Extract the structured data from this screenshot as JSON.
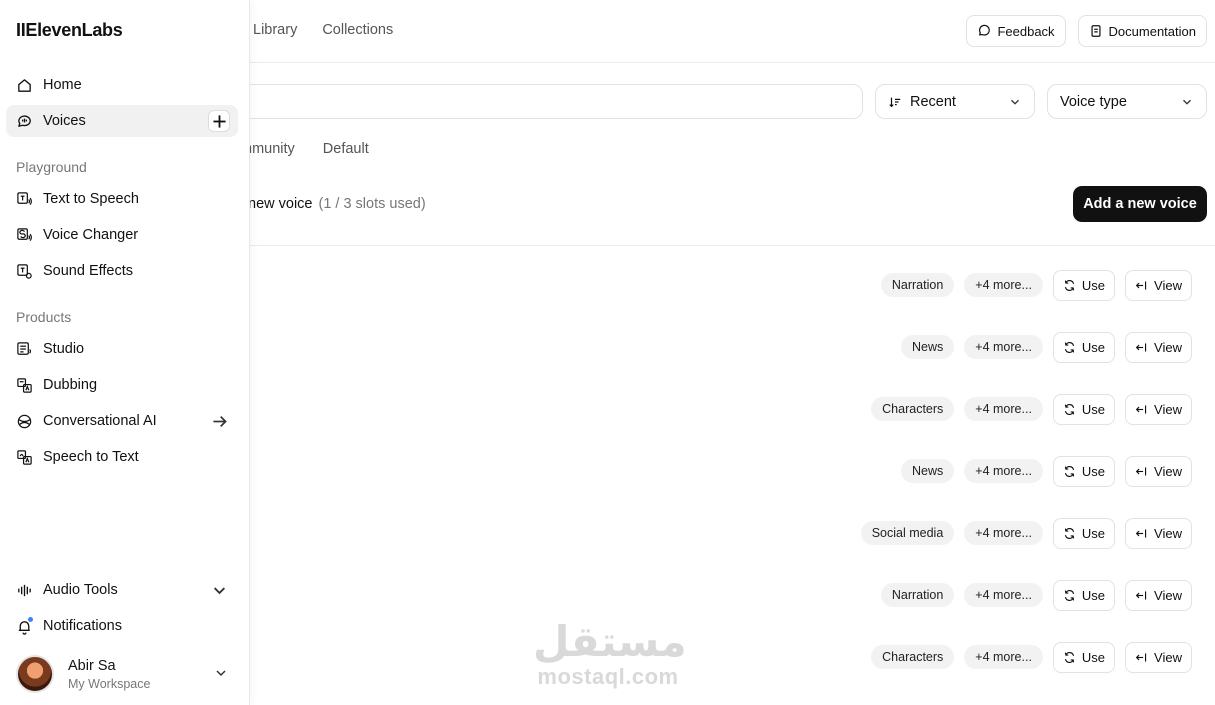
{
  "app": {
    "logo": "IIElevenLabs"
  },
  "top_tabs": [
    "Library",
    "Collections"
  ],
  "top_actions": {
    "feedback": "Feedback",
    "documentation": "Documentation"
  },
  "filters": {
    "sort": "Recent",
    "voice_type": "Voice type"
  },
  "filter_tabs": [
    "Community",
    "Default"
  ],
  "filter_tabs_visible": [
    "mmunity",
    "Default"
  ],
  "slots": {
    "label": "new voice",
    "usage": "(1 / 3 slots used)",
    "add_button": "Add a new voice"
  },
  "voice_rows": [
    {
      "tag": "Narration",
      "more": "+4 more...",
      "use": "Use",
      "view": "View"
    },
    {
      "tag": "News",
      "more": "+4 more...",
      "use": "Use",
      "view": "View"
    },
    {
      "tag": "Characters",
      "more": "+4 more...",
      "use": "Use",
      "view": "View"
    },
    {
      "tag": "News",
      "more": "+4 more...",
      "use": "Use",
      "view": "View"
    },
    {
      "tag": "Social media",
      "more": "+4 more...",
      "use": "Use",
      "view": "View"
    },
    {
      "tag": "Narration",
      "more": "+4 more...",
      "use": "Use",
      "view": "View"
    },
    {
      "tag": "Characters",
      "more": "+4 more...",
      "use": "Use",
      "view": "View"
    }
  ],
  "sidebar": {
    "home": "Home",
    "voices": "Voices",
    "playground_label": "Playground",
    "playground": [
      "Text to Speech",
      "Voice Changer",
      "Sound Effects"
    ],
    "products_label": "Products",
    "products": [
      "Studio",
      "Dubbing",
      "Conversational AI",
      "Speech to Text"
    ],
    "audio_tools": "Audio Tools",
    "notifications": "Notifications",
    "user": {
      "name": "Abir Sa",
      "workspace": "My Workspace"
    }
  },
  "watermark": {
    "arabic": "مستقل",
    "latin": "mostaql.com"
  }
}
